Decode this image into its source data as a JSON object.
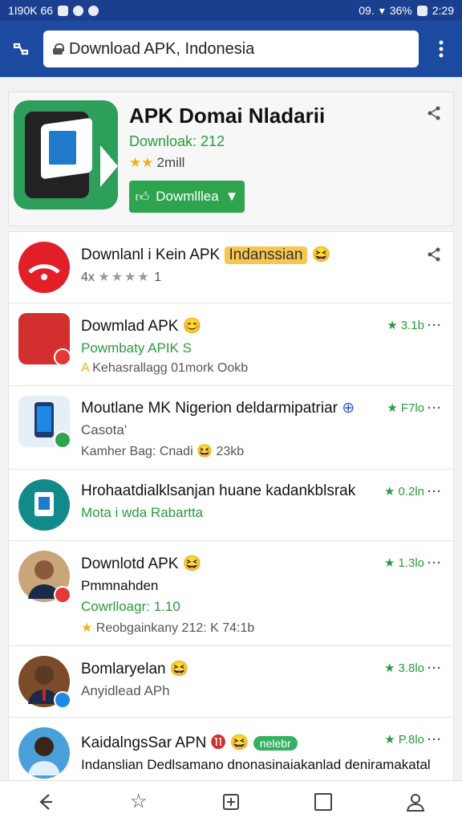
{
  "status_bar": {
    "left_text": "1I90K 66",
    "battery": "36%",
    "time": "2:29",
    "signal": "09."
  },
  "toolbar": {
    "url": "Download APK, Indonesia"
  },
  "hero": {
    "title": "APK Domai Nladarii",
    "subtitle": "Downloak: 212",
    "meta": "2mill",
    "button_label": "Dowmlllea"
  },
  "list": [
    {
      "title": "Downlanl i Kein APK",
      "pill": "Indanssian",
      "meta": "1",
      "meta_stars": "★★★★",
      "meta_prefix": "4x",
      "color": "#e21f26",
      "shape": "circle"
    },
    {
      "title": "Dowmlad APK",
      "sub": "Powmbaty APIK S",
      "meta": "Kehasrallagg 01mork Ookb",
      "rating": "3.1b",
      "color": "#d32f2f",
      "shape": "sq"
    },
    {
      "title": "Moutlane MK Nigerion deldarmipatriar",
      "sub": "Casota'",
      "meta": "Kamher Bag: Cnadi 😆 23kb",
      "rating": "F7lo",
      "color": "#1e88e5",
      "shape": "sq"
    },
    {
      "title": "Hrohaatdialklsanjan huane kadankblsrak",
      "sub": "Mota i wda Rabartta",
      "meta": "",
      "rating": "0.2ln",
      "color": "#138a8a",
      "shape": "circle"
    },
    {
      "title": "Downlotd APK",
      "sub": "Pmmnahden",
      "sub2": "Cowrlloagr: 1.10",
      "meta": "Reobgainkany 212: K 74:1b",
      "rating": "1.3lo",
      "color": "#caa57a",
      "shape": "circle"
    },
    {
      "title": "Bomlaryelan",
      "sub": "Anyidlead APh",
      "meta": "",
      "rating": "3.8lo",
      "color": "#7b4b2a",
      "shape": "circle"
    },
    {
      "title": "KaidalngsSar APN",
      "pill": "nelebr",
      "sub": "Indanslian Dedlsamano dnonasinaiakanlad deniramakatal",
      "rating": "P.8lo",
      "color": "#4aa0d8",
      "shape": "circle"
    }
  ]
}
